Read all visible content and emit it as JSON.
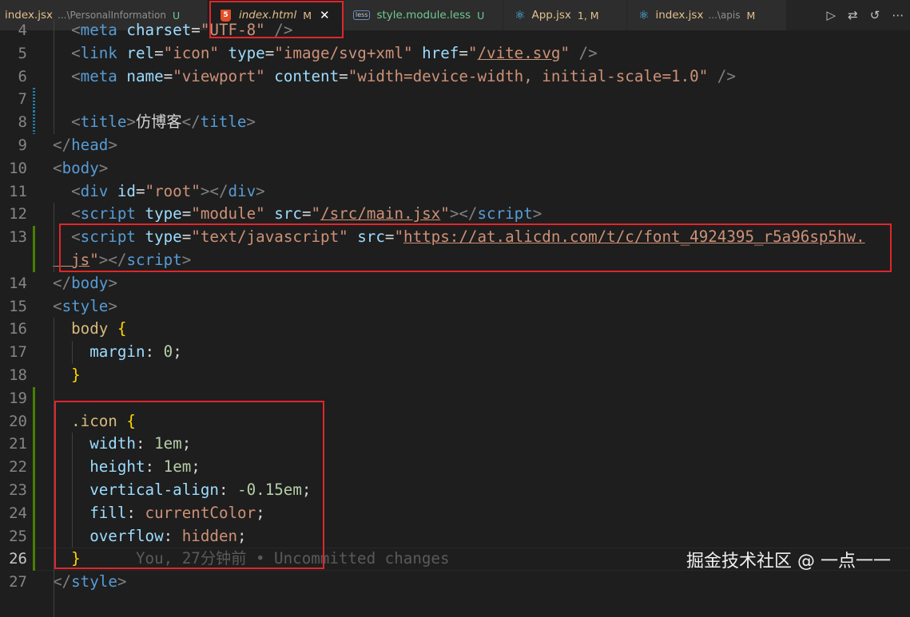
{
  "tabs": [
    {
      "name": "index.jsx",
      "path": "...\\PersonalInformation",
      "status": "U",
      "icon": "react-icon"
    },
    {
      "name": "index.html",
      "path": "",
      "status": "M",
      "icon": "html5-icon",
      "active": true,
      "close": "✕"
    },
    {
      "name": "style.module.less",
      "path": "",
      "status": "U",
      "icon": "less-icon"
    },
    {
      "name": "App.jsx",
      "path": "",
      "status": "1, M",
      "icon": "react-icon"
    },
    {
      "name": "index.jsx",
      "path": "...\\apis",
      "status": "M",
      "icon": "react-icon"
    }
  ],
  "tab_actions": {
    "run": "▷",
    "compare": "⇄",
    "go_back": "↺",
    "more": "⋯"
  },
  "editor": {
    "lines": [
      {
        "n": "4",
        "tokens": [
          [
            "t-br",
            "  <"
          ],
          [
            "t-tag",
            "meta"
          ],
          [
            "t-attr",
            " charset"
          ],
          [
            "t-punct",
            "="
          ],
          [
            "t-str",
            "\"UTF-8\""
          ],
          [
            "t-br",
            " />"
          ]
        ]
      },
      {
        "n": "5",
        "tokens": [
          [
            "t-br",
            "  <"
          ],
          [
            "t-tag",
            "link"
          ],
          [
            "t-attr",
            " rel"
          ],
          [
            "t-punct",
            "="
          ],
          [
            "t-str",
            "\"icon\""
          ],
          [
            "t-attr",
            " type"
          ],
          [
            "t-punct",
            "="
          ],
          [
            "t-str",
            "\"image/svg+xml\""
          ],
          [
            "t-attr",
            " href"
          ],
          [
            "t-punct",
            "="
          ],
          [
            "t-str",
            "\""
          ],
          [
            "t-str link",
            "/vite.svg"
          ],
          [
            "t-str",
            "\""
          ],
          [
            "t-br",
            " />"
          ]
        ]
      },
      {
        "n": "6",
        "tokens": [
          [
            "t-br",
            "  <"
          ],
          [
            "t-tag",
            "meta"
          ],
          [
            "t-attr",
            " name"
          ],
          [
            "t-punct",
            "="
          ],
          [
            "t-str",
            "\"viewport\""
          ],
          [
            "t-attr",
            " content"
          ],
          [
            "t-punct",
            "="
          ],
          [
            "t-str",
            "\"width=device-width, initial-scale=1.0\""
          ],
          [
            "t-br",
            " />"
          ]
        ]
      },
      {
        "n": "7",
        "tokens": []
      },
      {
        "n": "8",
        "tokens": [
          [
            "t-br",
            "  <"
          ],
          [
            "t-tag",
            "title"
          ],
          [
            "t-br",
            ">"
          ],
          [
            "t-txt",
            "仿博客"
          ],
          [
            "t-br",
            "</"
          ],
          [
            "t-tag",
            "title"
          ],
          [
            "t-br",
            ">"
          ]
        ]
      },
      {
        "n": "9",
        "tokens": [
          [
            "t-br",
            "</"
          ],
          [
            "t-tag",
            "head"
          ],
          [
            "t-br",
            ">"
          ]
        ]
      },
      {
        "n": "10",
        "tokens": [
          [
            "t-br",
            "<"
          ],
          [
            "t-tag",
            "body"
          ],
          [
            "t-br",
            ">"
          ]
        ]
      },
      {
        "n": "11",
        "tokens": [
          [
            "t-br",
            "  <"
          ],
          [
            "t-tag",
            "div"
          ],
          [
            "t-attr",
            " id"
          ],
          [
            "t-punct",
            "="
          ],
          [
            "t-str",
            "\"root\""
          ],
          [
            "t-br",
            "></"
          ],
          [
            "t-tag",
            "div"
          ],
          [
            "t-br",
            ">"
          ]
        ]
      },
      {
        "n": "12",
        "tokens": [
          [
            "t-br",
            "  <"
          ],
          [
            "t-tag",
            "script"
          ],
          [
            "t-attr",
            " type"
          ],
          [
            "t-punct",
            "="
          ],
          [
            "t-str",
            "\"module\""
          ],
          [
            "t-attr",
            " src"
          ],
          [
            "t-punct",
            "="
          ],
          [
            "t-str",
            "\""
          ],
          [
            "t-str link",
            "/src/main.jsx"
          ],
          [
            "t-str",
            "\""
          ],
          [
            "t-br",
            "></"
          ],
          [
            "t-tag",
            "script"
          ],
          [
            "t-br",
            ">"
          ]
        ]
      },
      {
        "n": "13",
        "tokens": [
          [
            "t-br",
            "  <"
          ],
          [
            "t-tag",
            "script"
          ],
          [
            "t-attr",
            " type"
          ],
          [
            "t-punct",
            "="
          ],
          [
            "t-str",
            "\"text/javascript\""
          ],
          [
            "t-attr",
            " src"
          ],
          [
            "t-punct",
            "="
          ],
          [
            "t-str",
            "\""
          ],
          [
            "t-str link",
            "https://at.alicdn.com/t/c/font_4924395_r5a96sp5hw."
          ]
        ]
      },
      {
        "n": "",
        "tokens": [
          [
            "t-str link",
            "  js"
          ],
          [
            "t-str",
            "\""
          ],
          [
            "t-br",
            "></"
          ],
          [
            "t-tag",
            "script"
          ],
          [
            "t-br",
            ">"
          ]
        ]
      },
      {
        "n": "14",
        "tokens": [
          [
            "t-br",
            "</"
          ],
          [
            "t-tag",
            "body"
          ],
          [
            "t-br",
            ">"
          ]
        ]
      },
      {
        "n": "15",
        "tokens": [
          [
            "t-br",
            "<"
          ],
          [
            "t-tag",
            "style"
          ],
          [
            "t-br",
            ">"
          ]
        ]
      },
      {
        "n": "16",
        "tokens": [
          [
            "t-sel",
            "  body"
          ],
          [
            "t-brace",
            " {"
          ]
        ]
      },
      {
        "n": "17",
        "tokens": [
          [
            "t-prop",
            "    margin"
          ],
          [
            "t-punct",
            ": "
          ],
          [
            "t-num",
            "0"
          ],
          [
            "t-punct",
            ";"
          ]
        ]
      },
      {
        "n": "18",
        "tokens": [
          [
            "t-brace",
            "  }"
          ]
        ]
      },
      {
        "n": "19",
        "tokens": []
      },
      {
        "n": "20",
        "tokens": [
          [
            "t-sel",
            "  .icon"
          ],
          [
            "t-brace",
            " {"
          ]
        ]
      },
      {
        "n": "21",
        "tokens": [
          [
            "t-prop",
            "    width"
          ],
          [
            "t-punct",
            ": "
          ],
          [
            "t-num",
            "1em"
          ],
          [
            "t-punct",
            ";"
          ]
        ]
      },
      {
        "n": "22",
        "tokens": [
          [
            "t-prop",
            "    height"
          ],
          [
            "t-punct",
            ": "
          ],
          [
            "t-num",
            "1em"
          ],
          [
            "t-punct",
            ";"
          ]
        ]
      },
      {
        "n": "23",
        "tokens": [
          [
            "t-prop",
            "    vertical-align"
          ],
          [
            "t-punct",
            ": "
          ],
          [
            "t-num",
            "-0.15em"
          ],
          [
            "t-punct",
            ";"
          ]
        ]
      },
      {
        "n": "24",
        "tokens": [
          [
            "t-prop",
            "    fill"
          ],
          [
            "t-punct",
            ": "
          ],
          [
            "t-kw",
            "currentColor"
          ],
          [
            "t-punct",
            ";"
          ]
        ]
      },
      {
        "n": "25",
        "tokens": [
          [
            "t-prop",
            "    overflow"
          ],
          [
            "t-punct",
            ": "
          ],
          [
            "t-kw",
            "hidden"
          ],
          [
            "t-punct",
            ";"
          ]
        ]
      },
      {
        "n": "26",
        "tokens": [
          [
            "t-brace",
            "  }"
          ]
        ],
        "blame": "      You, 27分钟前 • Uncommitted changes",
        "current": true
      },
      {
        "n": "27",
        "tokens": [
          [
            "t-br",
            "</"
          ],
          [
            "t-tag",
            "style"
          ],
          [
            "t-br",
            ">"
          ]
        ]
      }
    ]
  },
  "watermark": "掘金技术社区 @ 一点一一"
}
